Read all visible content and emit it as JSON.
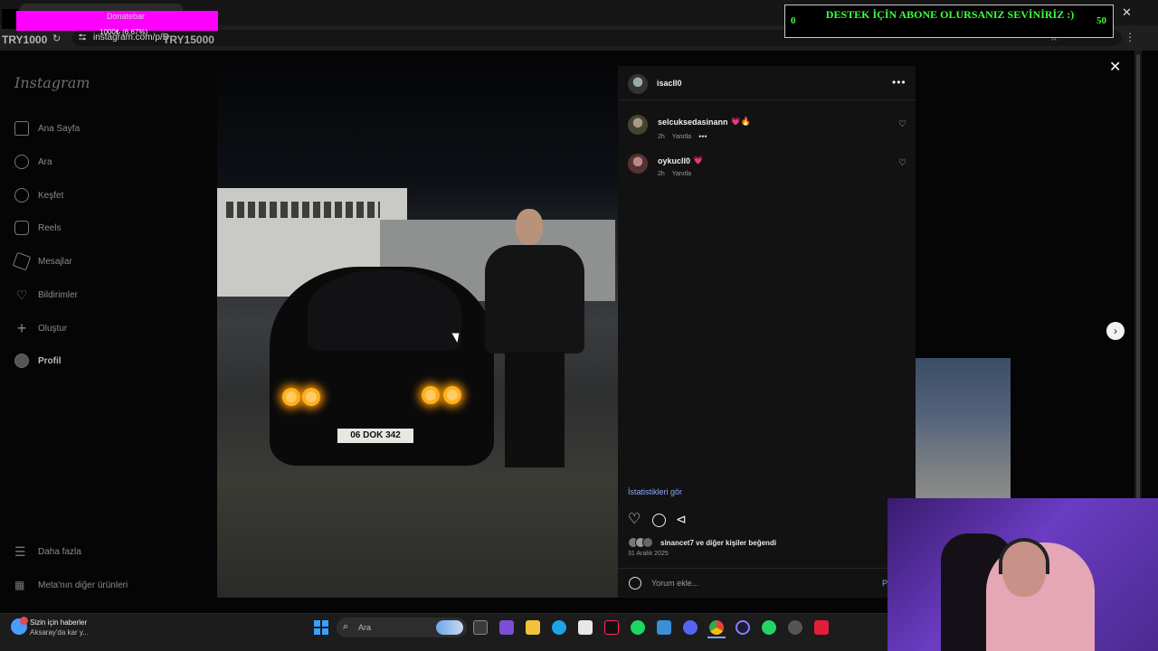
{
  "browser": {
    "url": "instagram.com/p/D",
    "donate_label": "Donatebar",
    "donate_progress": "1000₺ (6.67%)",
    "try_left": "TRY1000",
    "try_right": "TRY15000"
  },
  "subscribe_overlay": {
    "text": "DESTEK İÇİN ABONE OLURSANIZ SEVİNİRİZ :)",
    "left_count": "0",
    "right_count": "50"
  },
  "instagram": {
    "logo": "Instagram",
    "nav": {
      "home": "Ana Sayfa",
      "search": "Ara",
      "explore": "Keşfet",
      "reels": "Reels",
      "messages": "Mesajlar",
      "notifications": "Bildirimler",
      "create": "Oluştur",
      "profile": "Profil",
      "more": "Daha fazla",
      "meta": "Meta'nın diğer ürünleri"
    },
    "post": {
      "owner": "isacll0",
      "plate": "06 DOK 342",
      "comments": [
        {
          "user": "selcuksedasinann",
          "emoji": "💗🔥",
          "time": "2h",
          "reply": "Yanıtla"
        },
        {
          "user": "oykucll0",
          "emoji": "💗",
          "time": "2h",
          "reply": "Yanıtla"
        }
      ],
      "stats_link": "İstatistikleri gör",
      "likers_user": "sinancet7",
      "likers_rest": " ve diğer kişiler beğendi",
      "date": "31 Aralık 2025",
      "comment_placeholder": "Yorum ekle...",
      "post_button": "P"
    }
  },
  "taskbar": {
    "news_title": "Sizin için haberler",
    "news_sub": "Aksaray'da kar y...",
    "search_label": "Ara"
  },
  "colors": {
    "donate_bar": "#ff00ff",
    "subscribe_text": "#3dff3d",
    "link_blue": "#8ea7ff"
  }
}
